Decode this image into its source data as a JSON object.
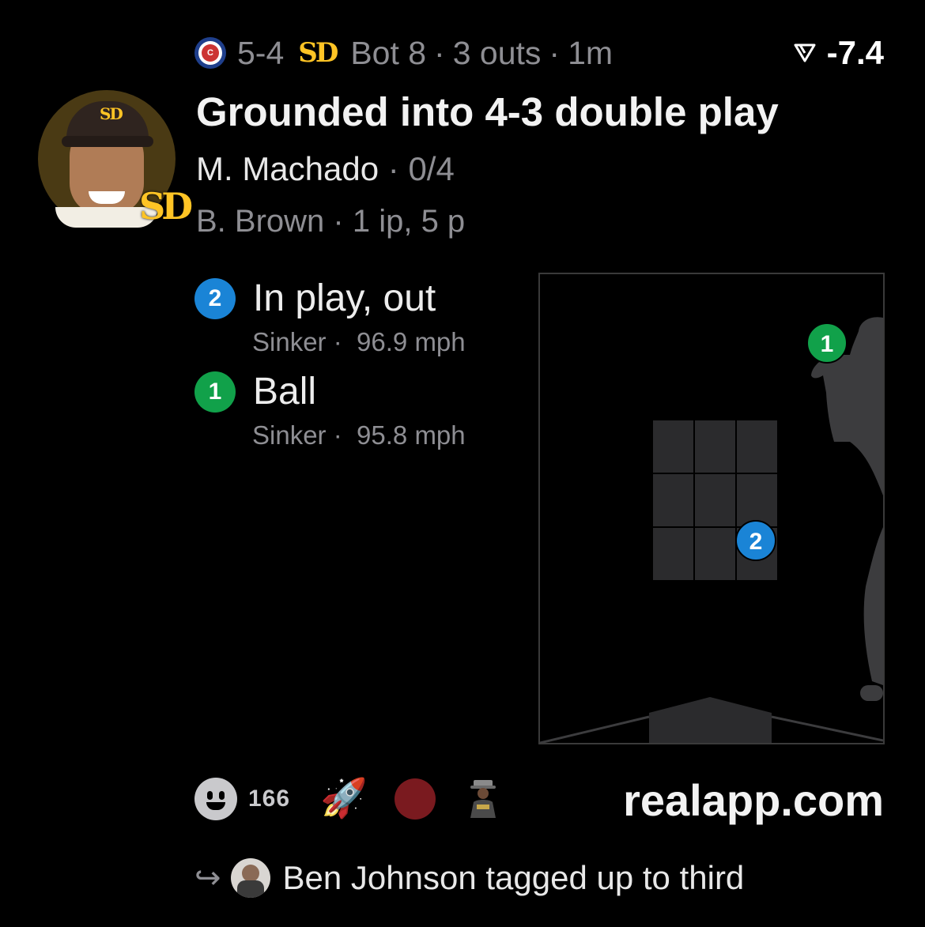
{
  "header": {
    "home_team_icon": "cubs-logo-icon",
    "score": "5-4",
    "away_team_icon": "padres-logo-icon",
    "away_team_logo_text": "SD",
    "inning": "Bot 8",
    "outs": "3 outs",
    "time_ago": "1m",
    "delta_icon": "trend-triangle-icon",
    "delta_value": "-7.4"
  },
  "play": {
    "title": "Grounded into 4-3 double play",
    "batter_name": "M. Machado",
    "batter_stat": "0/4",
    "pitcher_name": "B. Brown",
    "pitcher_stat": "1 ip, 5 p",
    "avatar_team_text": "SD"
  },
  "pitches": [
    {
      "number": "2",
      "result": "In play, out",
      "type": "Sinker",
      "speed": "96.9 mph",
      "color": "#1a84d6"
    },
    {
      "number": "1",
      "result": "Ball",
      "type": "Sinker",
      "speed": "95.8 mph",
      "color": "#11a14a"
    }
  ],
  "footer": {
    "reaction_icon": "smiley-face-icon",
    "reaction_count": "166",
    "reaction_emojis": [
      "rocket",
      "red-circle",
      "person"
    ],
    "rocket_glyph": "🚀",
    "brand": "realapp.com"
  },
  "reply": {
    "arrow_glyph": "↪",
    "text": "Ben Johnson tagged up to third"
  },
  "colors": {
    "background": "#000000",
    "muted_text": "#8e8e93",
    "padres_gold": "#ffc425",
    "zone_cell": "#2b2b2d",
    "silhouette": "#3c3c3e"
  }
}
